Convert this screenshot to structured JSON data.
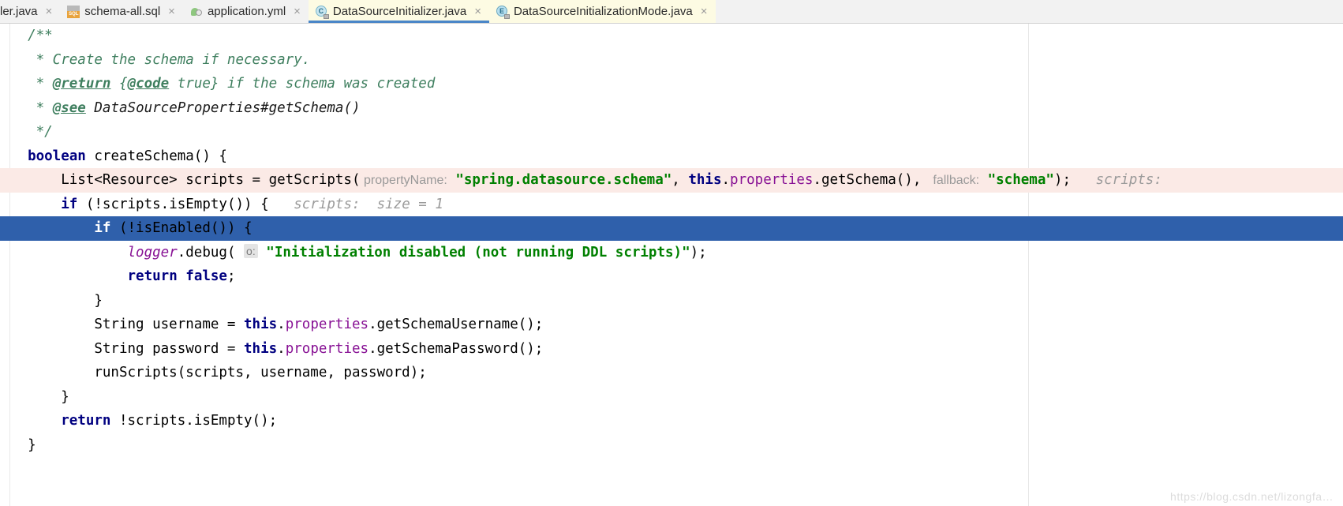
{
  "window": {
    "active_file": "DataSourceInitializer.java",
    "watermark": "https://blog.csdn.net/lizongfa…"
  },
  "colors": {
    "tab_active_bg": "#fdfbe3",
    "tab_bar_bg": "#f2f2f2",
    "tab_underline": "#4a86c8",
    "selection_blue": "#2f60ab",
    "modified_line_pink": "#fbeae6",
    "keyword": "#000080",
    "string": "#008000",
    "comment": "#3f7f5f",
    "field": "#871094",
    "inlay_hint": "#999999",
    "margin_guide": "#e6e6e6"
  },
  "tabs": [
    {
      "label": "ler.java",
      "icon": "java-class-icon",
      "state": "clipped",
      "close": "×"
    },
    {
      "label": "schema-all.sql",
      "icon": "sql-file-icon",
      "state": "inactive",
      "close": "×"
    },
    {
      "label": "application.yml",
      "icon": "yaml-file-icon",
      "state": "inactive",
      "close": "×"
    },
    {
      "label": "DataSourceInitializer.java",
      "icon": "java-class-icon",
      "state": "active",
      "close": "×",
      "icon_letter": "C"
    },
    {
      "label": "DataSourceInitializationMode.java",
      "icon": "java-enum-icon",
      "state": "inactive-yellow",
      "close": "×",
      "icon_letter": "E"
    }
  ],
  "code": {
    "lines": [
      {
        "highlight": "none",
        "tokens": [
          {
            "t": "  ",
            "c": "plain"
          },
          {
            "t": "/**",
            "c": "cmt"
          }
        ]
      },
      {
        "highlight": "none",
        "tokens": [
          {
            "t": "   * Create the schema if necessary.",
            "c": "cmt"
          }
        ]
      },
      {
        "highlight": "none",
        "tokens": [
          {
            "t": "   * ",
            "c": "cmt"
          },
          {
            "t": "@return",
            "c": "cmt-tag"
          },
          {
            "t": " {",
            "c": "cmt"
          },
          {
            "t": "@code",
            "c": "cmt-tag"
          },
          {
            "t": " true} if the schema was created",
            "c": "cmt"
          }
        ]
      },
      {
        "highlight": "none",
        "tokens": [
          {
            "t": "   * ",
            "c": "cmt"
          },
          {
            "t": "@see",
            "c": "cmt-tag"
          },
          {
            "t": " ",
            "c": "cmt"
          },
          {
            "t": "DataSourceProperties#getSchema()",
            "c": "cmt-lnk"
          }
        ]
      },
      {
        "highlight": "none",
        "tokens": [
          {
            "t": "   */",
            "c": "cmt"
          }
        ]
      },
      {
        "highlight": "none",
        "tokens": [
          {
            "t": "  ",
            "c": "plain"
          },
          {
            "t": "boolean",
            "c": "kw"
          },
          {
            "t": " createSchema() {",
            "c": "plain"
          }
        ]
      },
      {
        "highlight": "pink",
        "tokens": [
          {
            "t": "      List<Resource> scripts = getScripts(",
            "c": "plain"
          },
          {
            "t": " propertyName:",
            "c": "hint"
          },
          {
            "t": " ",
            "c": "plain"
          },
          {
            "t": "\"spring.datasource.schema\"",
            "c": "str"
          },
          {
            "t": ", ",
            "c": "plain"
          },
          {
            "t": "this",
            "c": "kw"
          },
          {
            "t": ".",
            "c": "plain"
          },
          {
            "t": "properties",
            "c": "field"
          },
          {
            "t": ".getSchema(), ",
            "c": "plain"
          },
          {
            "t": " fallback:",
            "c": "hint"
          },
          {
            "t": " ",
            "c": "plain"
          },
          {
            "t": "\"schema\"",
            "c": "str"
          },
          {
            "t": ");",
            "c": "plain"
          },
          {
            "t": "   scripts:",
            "c": "dbg"
          }
        ]
      },
      {
        "highlight": "none",
        "tokens": [
          {
            "t": "      ",
            "c": "plain"
          },
          {
            "t": "if",
            "c": "kw"
          },
          {
            "t": " (!scripts.isEmpty()) {",
            "c": "plain"
          },
          {
            "t": "   scripts:  size = 1",
            "c": "dbg"
          }
        ]
      },
      {
        "highlight": "blue",
        "tokens": [
          {
            "t": "          ",
            "c": "plain"
          },
          {
            "t": "if",
            "c": "kw-w"
          },
          {
            "t": " (!isEnabled()) {",
            "c": "plain"
          }
        ]
      },
      {
        "highlight": "none",
        "tokens": [
          {
            "t": "              ",
            "c": "plain"
          },
          {
            "t": "logger",
            "c": "sfield"
          },
          {
            "t": ".debug(",
            "c": "plain"
          },
          {
            "t": " ",
            "c": "plain"
          },
          {
            "t": "o:",
            "c": "badge"
          },
          {
            "t": " ",
            "c": "plain"
          },
          {
            "t": "\"Initialization disabled (not running DDL scripts)\"",
            "c": "str"
          },
          {
            "t": ");",
            "c": "plain"
          }
        ]
      },
      {
        "highlight": "none",
        "tokens": [
          {
            "t": "              ",
            "c": "plain"
          },
          {
            "t": "return",
            "c": "kw"
          },
          {
            "t": " ",
            "c": "plain"
          },
          {
            "t": "false",
            "c": "kw"
          },
          {
            "t": ";",
            "c": "plain"
          }
        ]
      },
      {
        "highlight": "none",
        "tokens": [
          {
            "t": "          }",
            "c": "plain"
          }
        ]
      },
      {
        "highlight": "none",
        "tokens": [
          {
            "t": "          String username = ",
            "c": "plain"
          },
          {
            "t": "this",
            "c": "kw"
          },
          {
            "t": ".",
            "c": "plain"
          },
          {
            "t": "properties",
            "c": "field"
          },
          {
            "t": ".getSchemaUsername();",
            "c": "plain"
          }
        ]
      },
      {
        "highlight": "none",
        "tokens": [
          {
            "t": "          String password = ",
            "c": "plain"
          },
          {
            "t": "this",
            "c": "kw"
          },
          {
            "t": ".",
            "c": "plain"
          },
          {
            "t": "properties",
            "c": "field"
          },
          {
            "t": ".getSchemaPassword();",
            "c": "plain"
          }
        ]
      },
      {
        "highlight": "none",
        "tokens": [
          {
            "t": "          runScripts(scripts, username, password);",
            "c": "plain"
          }
        ]
      },
      {
        "highlight": "none",
        "tokens": [
          {
            "t": "      }",
            "c": "plain"
          }
        ]
      },
      {
        "highlight": "none",
        "tokens": [
          {
            "t": "      ",
            "c": "plain"
          },
          {
            "t": "return",
            "c": "kw"
          },
          {
            "t": " !scripts.isEmpty();",
            "c": "plain"
          }
        ]
      },
      {
        "highlight": "none",
        "tokens": [
          {
            "t": "  }",
            "c": "plain"
          }
        ]
      }
    ]
  }
}
